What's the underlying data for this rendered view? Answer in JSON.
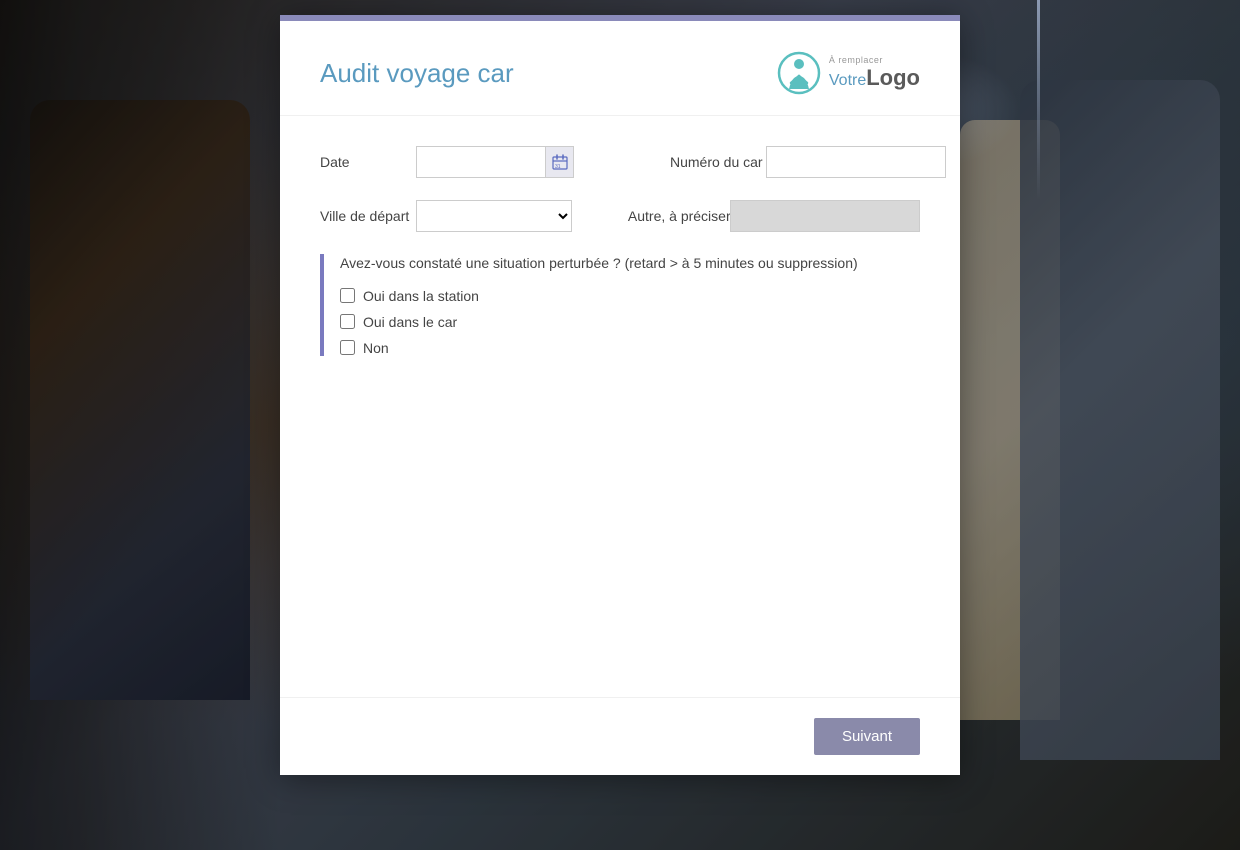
{
  "background": {
    "description": "Bus interior background"
  },
  "modal": {
    "title": "Audit voyage car",
    "logo": {
      "remplacer_label": "À remplacer",
      "votre_text": "Votre",
      "logo_text": "Logo"
    },
    "form": {
      "date_label": "Date",
      "date_placeholder": "",
      "numero_label": "Numéro du car",
      "numero_placeholder": "",
      "ville_label": "Ville de départ",
      "ville_placeholder": "",
      "ville_options": [
        ""
      ],
      "autre_label": "Autre, à préciser...",
      "autre_placeholder": "",
      "calendar_icon": "📅"
    },
    "question": {
      "text": "Avez-vous constaté une situation perturbée ? (retard > à 5 minutes ou suppression)",
      "options": [
        {
          "id": "oui-station",
          "label": "Oui dans la station",
          "checked": false
        },
        {
          "id": "oui-car",
          "label": "Oui dans le car",
          "checked": false
        },
        {
          "id": "non",
          "label": "Non",
          "checked": false
        }
      ]
    },
    "footer": {
      "suivant_label": "Suivant"
    }
  }
}
